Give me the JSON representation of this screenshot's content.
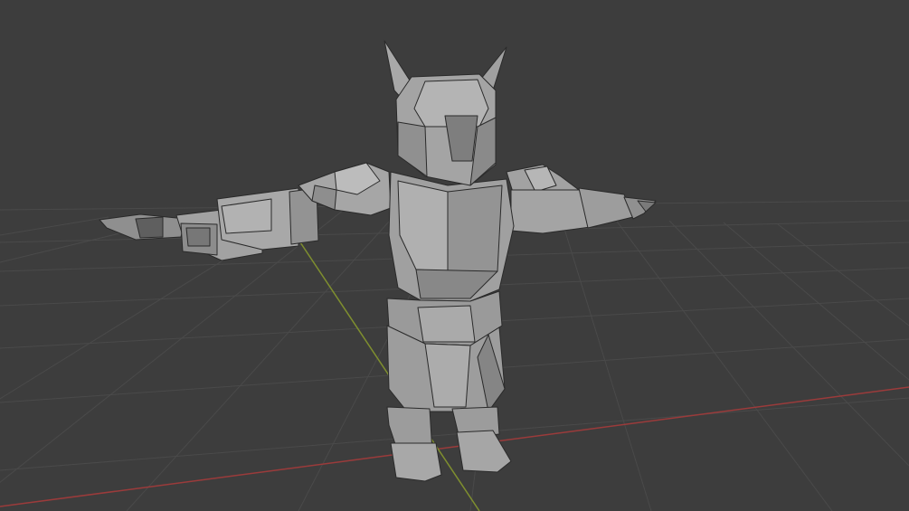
{
  "viewport": {
    "mode": "solid",
    "shading": "wireframe-overlay",
    "background_color": "#3d3d3d",
    "grid_color": "#4a4a4a",
    "x_axis_color": "#9b3b3b",
    "y_axis_color": "#7f8f2f"
  },
  "model": {
    "type": "low-poly-knight-character",
    "pose": "t-pose",
    "base_color": "#9a9a9a",
    "edge_color": "#2a2a2a"
  }
}
